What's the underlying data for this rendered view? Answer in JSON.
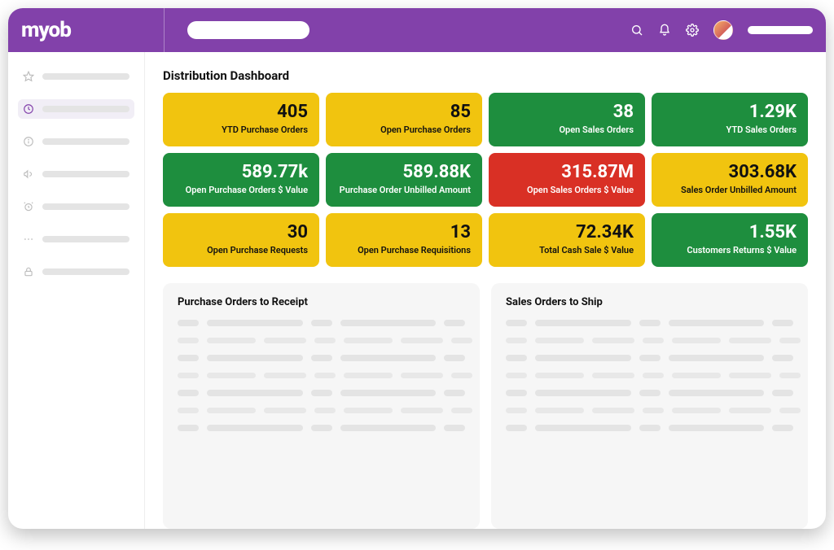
{
  "brand": {
    "logo_text": "myob"
  },
  "page": {
    "title": "Distribution Dashboard"
  },
  "colors": {
    "purple": "#8241aa",
    "yellow": "#f1c40f",
    "green": "#1e8e3e",
    "red": "#d93025"
  },
  "cards": {
    "row1": [
      {
        "value": "405",
        "label": "YTD Purchase Orders",
        "color": "yellow"
      },
      {
        "value": "85",
        "label": "Open Purchase Orders",
        "color": "yellow"
      },
      {
        "value": "38",
        "label": "Open Sales Orders",
        "color": "green"
      },
      {
        "value": "1.29K",
        "label": "YTD Sales Orders",
        "color": "green"
      }
    ],
    "row2": [
      {
        "value": "589.77k",
        "label": "Open Purchase Orders $ Value",
        "color": "green"
      },
      {
        "value": "589.88K",
        "label": "Purchase Order Unbilled Amount",
        "color": "green"
      },
      {
        "value": "315.87M",
        "label": "Open Sales Orders $ Value",
        "color": "red"
      },
      {
        "value": "303.68K",
        "label": "Sales Order Unbilled Amount",
        "color": "yellow"
      }
    ],
    "row3": [
      {
        "value": "30",
        "label": "Open Purchase Requests",
        "color": "yellow"
      },
      {
        "value": "13",
        "label": "Open Purchase Requisitions",
        "color": "yellow"
      },
      {
        "value": "72.34K",
        "label": "Total Cash Sale $ Value",
        "color": "yellow"
      },
      {
        "value": "1.55K",
        "label": "Customers Returns $ Value",
        "color": "green"
      }
    ]
  },
  "panels": {
    "left": {
      "title": "Purchase  Orders to Receipt"
    },
    "right": {
      "title": "Sales Orders to Ship"
    }
  }
}
